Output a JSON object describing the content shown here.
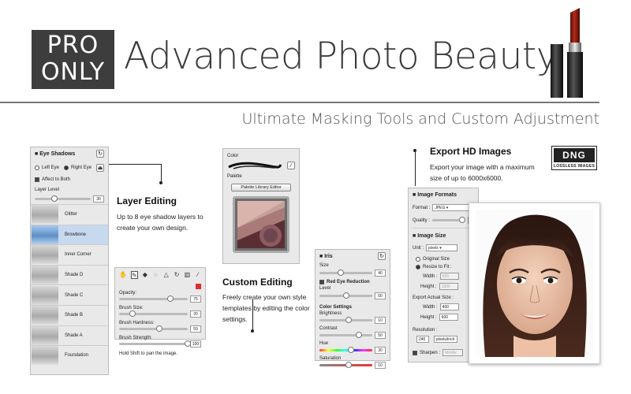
{
  "header": {
    "badge_line1": "PRO",
    "badge_line2": "ONLY",
    "title": "Advanced Photo Beauty",
    "subtitle": "Ultimate Masking Tools and Custom Adjustment"
  },
  "eye_panel": {
    "title": "Eye Shadows",
    "left_eye": "Left Eye",
    "right_eye": "Right Eye",
    "affect_both": "Affect to Both",
    "layer_level_label": "Layer Level",
    "layer_level_value": "30",
    "layers": [
      "Glitter",
      "Browbone",
      "Inner Corner",
      "Shade D",
      "Shade C",
      "Shade B",
      "Shade A",
      "Foundation"
    ],
    "selected_layer": "Browbone"
  },
  "layer_editing": {
    "heading": "Layer Editing",
    "text": "Up to 8 eye shadow layers to create your own design."
  },
  "brush_panel": {
    "opacity_label": "Opacity:",
    "opacity_value": "75",
    "opacity_level": 0.75,
    "size_label": "Brush Size:",
    "size_value": "20",
    "size_level": 0.2,
    "hardness_label": "Brush Hardness:",
    "hardness_value": "59",
    "hardness_level": 0.59,
    "strength_label": "Brush Strength:",
    "strength_value": "100",
    "strength_level": 1.0,
    "hint": "Hold Shift to pan the image.",
    "swatch_color": "#e32b2b"
  },
  "color_panel": {
    "color_label": "Color",
    "palette_label": "Palette",
    "palette_button": "Palette Library Editor"
  },
  "custom_editing": {
    "heading": "Custom Editing",
    "text": "Freely create your own style templates by editing the color settings."
  },
  "iris_panel": {
    "title": "Iris",
    "size_label": "Size",
    "size_value": "40",
    "size_level": 0.4,
    "red_eye_label": "Red Eye Reduction",
    "level_label": "Level",
    "level_value": "50",
    "level_level": 0.5,
    "color_settings_label": "Color Settings",
    "brightness_label": "Brightness",
    "brightness_value": "10",
    "brightness_level": 0.55,
    "contrast_label": "Contrast",
    "contrast_value": "50",
    "contrast_level": 0.75,
    "hue_label": "Hue",
    "hue_value": "30",
    "hue_level": 0.6,
    "saturation_label": "Saturation",
    "saturation_value": "10",
    "saturation_level": 0.55
  },
  "export": {
    "heading": "Export HD Images",
    "text": "Export your image with a maximum size of up to 6000x6000.",
    "dng_label": "DNG",
    "dng_sub": "LOSSLESS IMAGES"
  },
  "export_panel": {
    "formats_title": "Image Formats",
    "format_label": "Format :",
    "format_value": "JPEG",
    "quality_label": "Quality :",
    "quality_value": "10",
    "quality_level": 0.9,
    "size_title": "Image Size",
    "unit_label": "Unit :",
    "unit_value": "pixels",
    "original_size": "Original Size",
    "resize_to_fit": "Resize to Fit :",
    "width_label": "Width :",
    "width_value": "500",
    "height_label": "Height :",
    "height_value": "1000",
    "actual_size_label": "Export Actual Size :",
    "actual_width_label": "Width :",
    "actual_width_value": "400",
    "actual_height_label": "Height :",
    "actual_height_value": "600",
    "resolution_label": "Resolution :",
    "resolution_value": "240",
    "resolution_unit": "pixels/inch",
    "sharpen_label": "Sharpen :",
    "sharpen_value": "Middle"
  },
  "colors": {
    "badge_bg": "#3d3d3d",
    "lipstick": "#9c2415",
    "selection": "#c7d9ef"
  }
}
